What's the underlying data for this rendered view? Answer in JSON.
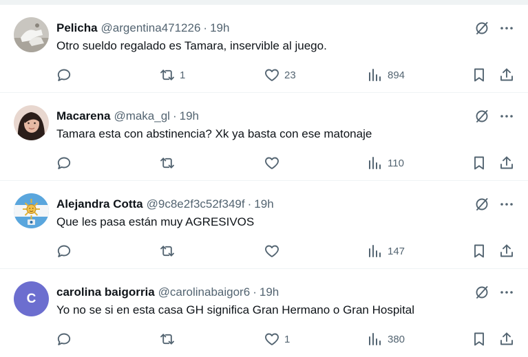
{
  "posts": [
    {
      "name": "Pelicha",
      "handle": "@argentina471226",
      "time": "19h",
      "text": "Otro sueldo regalado es Tamara, inservible al juego.",
      "replies": "",
      "retweets": "1",
      "likes": "23",
      "views": "894",
      "avatar_type": "photo-shoes"
    },
    {
      "name": "Macarena",
      "handle": "@maka_gl",
      "time": "19h",
      "text": "Tamara esta con abstinencia? Xk ya basta con ese matonaje",
      "replies": "",
      "retweets": "",
      "likes": "",
      "views": "110",
      "avatar_type": "photo-woman"
    },
    {
      "name": "Alejandra Cotta",
      "handle": "@9c8e2f3c52f349f",
      "time": "19h",
      "text": "Que les pasa están muy AGRESIVOS",
      "replies": "",
      "retweets": "",
      "likes": "",
      "views": "147",
      "avatar_type": "photo-sun-flag"
    },
    {
      "name": "carolina baigorria",
      "handle": "@carolinabaigor6",
      "time": "19h",
      "text": "Yo no se si en esta casa GH significa Gran Hermano o Gran Hospital",
      "replies": "",
      "retweets": "",
      "likes": "1",
      "views": "380",
      "avatar_type": "letter",
      "avatar_letter": "C",
      "avatar_color": "#6c6ecf"
    }
  ],
  "separator": "·",
  "colors": {
    "text": "#0f1419",
    "secondary": "#536471",
    "border": "#eff3f4"
  },
  "icons": [
    "reply-icon",
    "retweet-icon",
    "like-icon",
    "views-icon",
    "bookmark-icon",
    "share-icon",
    "mute-icon",
    "more-icon"
  ]
}
